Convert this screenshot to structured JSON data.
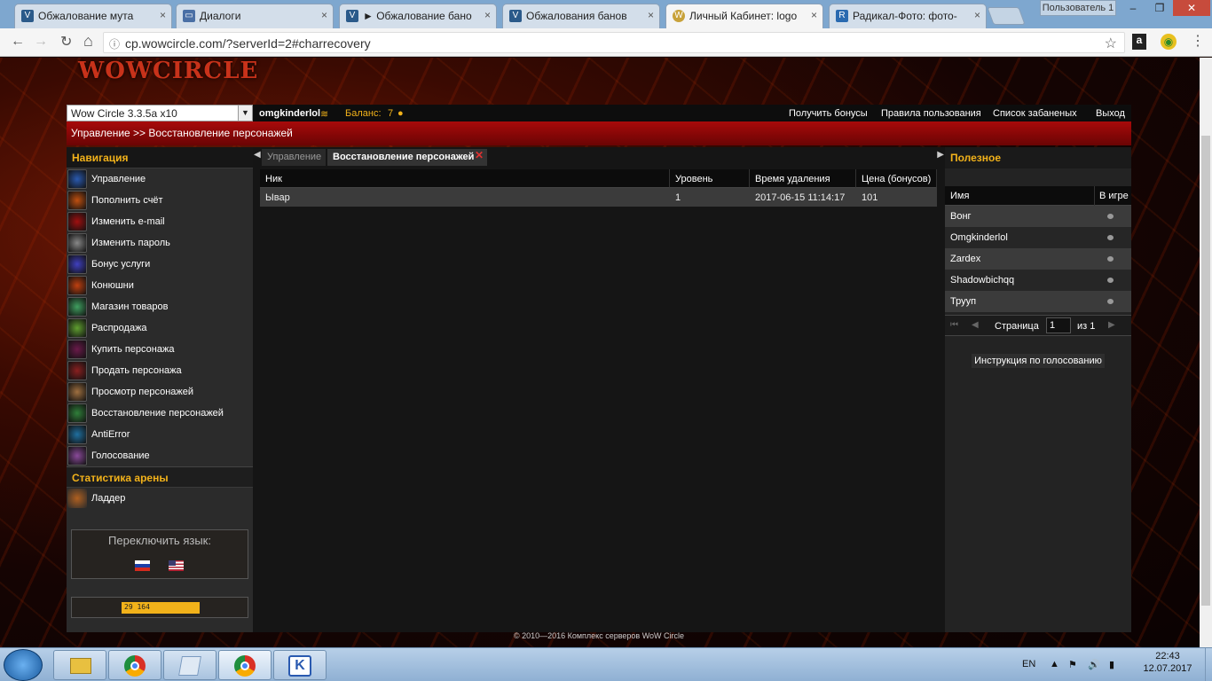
{
  "browser": {
    "tabs": [
      {
        "label": "Обжалование мута",
        "active": false
      },
      {
        "label": "Диалоги",
        "active": false
      },
      {
        "label": "► Обжалование бано",
        "active": false
      },
      {
        "label": "Обжалования банов",
        "active": false
      },
      {
        "label": "Личный Кабинет: logo",
        "active": true
      },
      {
        "label": "Радикал-Фото: фото-",
        "active": false
      }
    ],
    "user_label": "Пользователь 1",
    "url": "cp.wowcircle.com/?serverId=2#charrecovery"
  },
  "site": {
    "logo": "WOWCIRCLE",
    "realm_select": "Wow Circle 3.3.5a x10",
    "username": "omgkinderlol",
    "balance_label": "Баланс:",
    "balance_value": "7",
    "top_links": [
      "Получить бонусы",
      "Правила пользования",
      "Список забаненых",
      "Выход"
    ],
    "breadcrumb": "Управление >> Восстановление персонажей"
  },
  "nav": {
    "header": "Навигация",
    "items": [
      {
        "label": "Управление",
        "color": "#2a5ab0"
      },
      {
        "label": "Пополнить счёт",
        "color": "#c05010"
      },
      {
        "label": "Изменить e-mail",
        "color": "#a01010"
      },
      {
        "label": "Изменить пароль",
        "color": "#888888"
      },
      {
        "label": "Бонус услуги",
        "color": "#4040c0"
      },
      {
        "label": "Конюшни",
        "color": "#c04010"
      },
      {
        "label": "Магазин товаров",
        "color": "#40a060"
      },
      {
        "label": "Распродажа",
        "color": "#60a030"
      },
      {
        "label": "Купить персонажа",
        "color": "#6a1a4a"
      },
      {
        "label": "Продать персонажа",
        "color": "#8a2020"
      },
      {
        "label": "Просмотр персонажей",
        "color": "#a07040"
      },
      {
        "label": "Восстановление персонажей",
        "color": "#30803a"
      },
      {
        "label": "AntiError",
        "color": "#2070a0"
      },
      {
        "label": "Голосование",
        "color": "#8a4a9a"
      }
    ],
    "arena_header": "Статистика арены",
    "arena_items": [
      {
        "label": "Ладдер",
        "color": "#b06020"
      }
    ],
    "lang_title": "Переключить язык:",
    "counter": "29 164"
  },
  "main": {
    "tabs": [
      "Управление",
      "Восстановление персонажей"
    ],
    "columns": [
      "Ник",
      "Уровень",
      "Время удаления",
      "Цена (бонусов)"
    ],
    "rows": [
      [
        "Ывар",
        "1",
        "2017-06-15 11:14:17",
        "101"
      ]
    ]
  },
  "useful": {
    "header": "Полезное",
    "col_name": "Имя",
    "col_ingame": "В игре",
    "players": [
      "Вонг",
      "Omgkinderlol",
      "Zardex",
      "Shadowbichqq",
      "Трууп"
    ],
    "page_label": "Страница",
    "page_value": "1",
    "page_of": "из 1",
    "vote_button": "Инструкция по голосованию"
  },
  "footer": "© 2010—2016 Комплекс серверов WoW Circle",
  "taskbar": {
    "lang": "EN",
    "time": "22:43",
    "date": "12.07.2017"
  }
}
